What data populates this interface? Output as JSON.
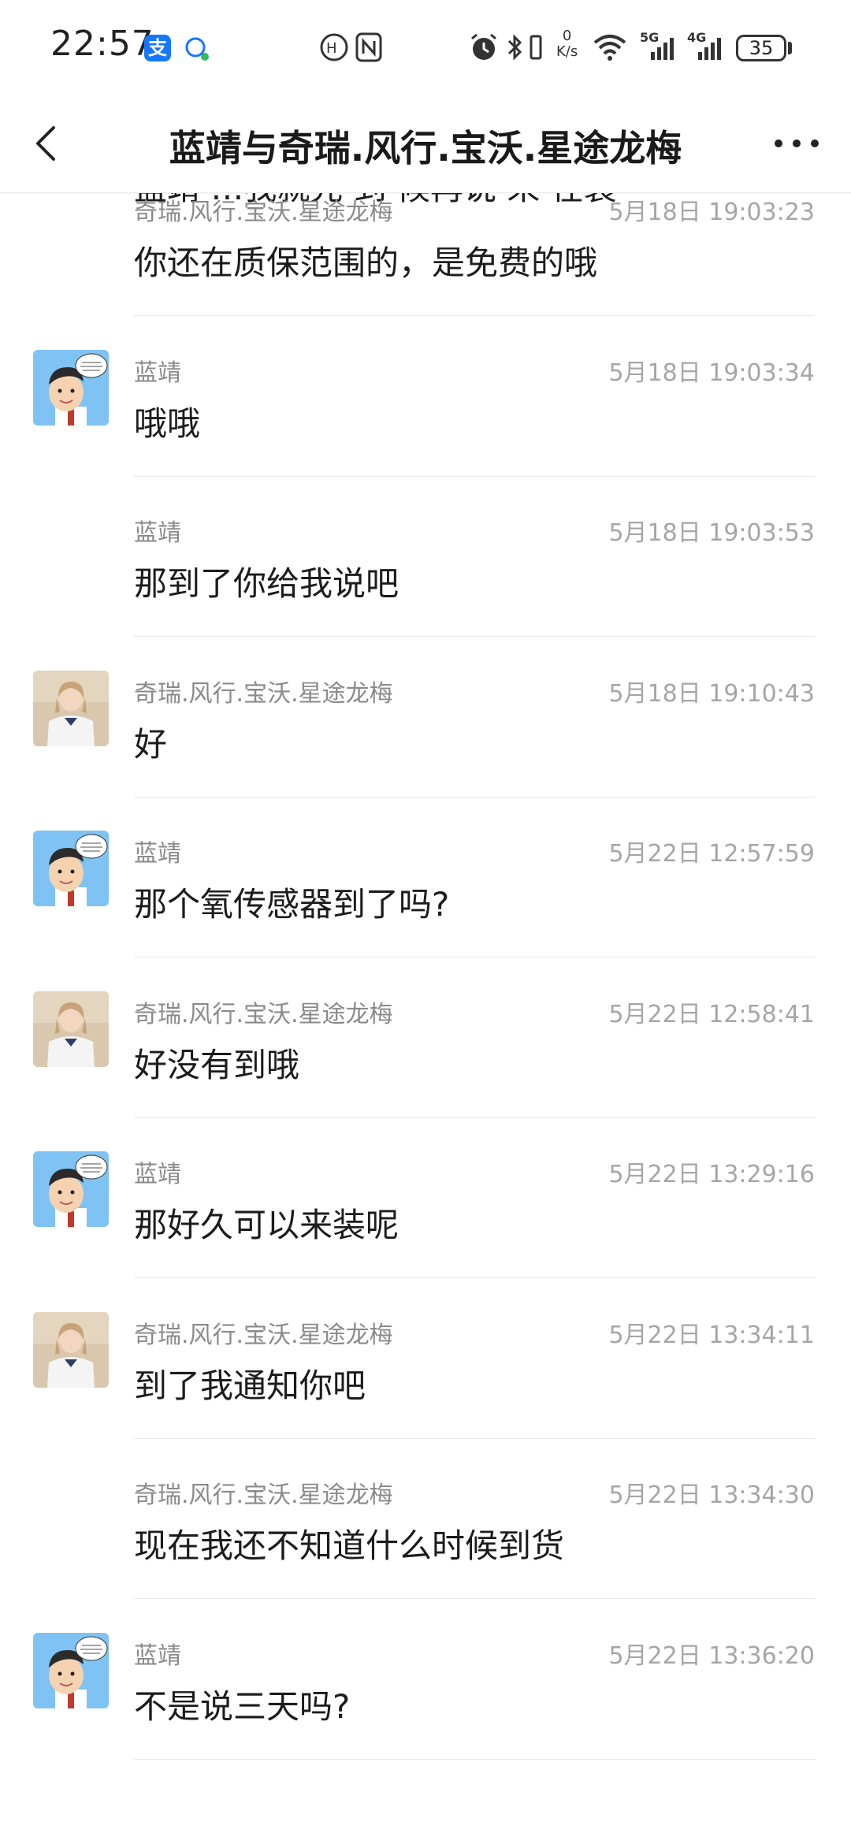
{
  "status_bar": {
    "time": "22:57",
    "alipay_glyph": "支",
    "net_speed_value": "0",
    "net_speed_unit": "K/s",
    "signal_5g": "5G",
    "signal_4g": "4G",
    "battery": "35"
  },
  "header": {
    "title": "蓝靖与奇瑞.风行.宝沃.星途龙梅"
  },
  "partial_top": {
    "text": "蓝靖 …我就先 到 候再说 来 在装"
  },
  "messages": [
    {
      "sender": "奇瑞.风行.宝沃.星途龙梅",
      "time": "5月18日 19:03:23",
      "text": "你还在质保范围的，是免费的哦",
      "avatar": "none"
    },
    {
      "sender": "蓝靖",
      "time": "5月18日 19:03:34",
      "text": "哦哦",
      "avatar": "cartoon"
    },
    {
      "sender": "蓝靖",
      "time": "5月18日 19:03:53",
      "text": "那到了你给我说吧",
      "avatar": "none"
    },
    {
      "sender": "奇瑞.风行.宝沃.星途龙梅",
      "time": "5月18日 19:10:43",
      "text": "好",
      "avatar": "photo"
    },
    {
      "sender": "蓝靖",
      "time": "5月22日 12:57:59",
      "text": "那个氧传感器到了吗?",
      "avatar": "cartoon"
    },
    {
      "sender": "奇瑞.风行.宝沃.星途龙梅",
      "time": "5月22日 12:58:41",
      "text": "好没有到哦",
      "avatar": "photo"
    },
    {
      "sender": "蓝靖",
      "time": "5月22日 13:29:16",
      "text": "那好久可以来装呢",
      "avatar": "cartoon"
    },
    {
      "sender": "奇瑞.风行.宝沃.星途龙梅",
      "time": "5月22日 13:34:11",
      "text": "到了我通知你吧",
      "avatar": "photo"
    },
    {
      "sender": "奇瑞.风行.宝沃.星途龙梅",
      "time": "5月22日 13:34:30",
      "text": "现在我还不知道什么时候到货",
      "avatar": "none"
    },
    {
      "sender": "蓝靖",
      "time": "5月22日 13:36:20",
      "text": "不是说三天吗?",
      "avatar": "cartoon"
    }
  ]
}
